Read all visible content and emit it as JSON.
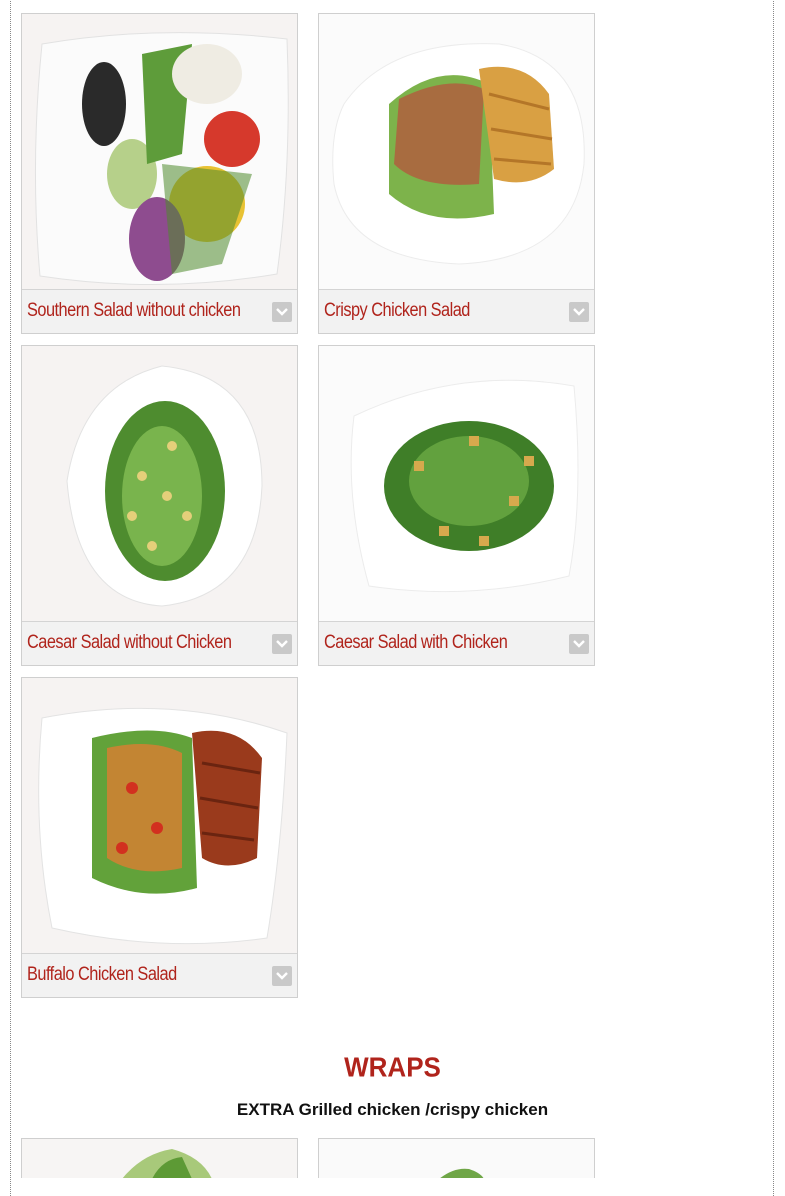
{
  "items": [
    {
      "name": "Southern Salad without chicken"
    },
    {
      "name": "Crispy Chicken Salad"
    },
    {
      "name": "Caesar Salad without Chicken"
    },
    {
      "name": "Caesar Salad with Chicken"
    },
    {
      "name": "Buffalo Chicken Salad"
    }
  ],
  "wraps_section": {
    "title": "WRAPS",
    "subtitle": "EXTRA Grilled chicken /crispy chicken"
  },
  "icons": {
    "expand": "chevron-down-icon"
  },
  "colors": {
    "accent": "#b0241c",
    "bar_bg": "#f2f2f2",
    "toggle_bg": "#c9c9c9"
  }
}
